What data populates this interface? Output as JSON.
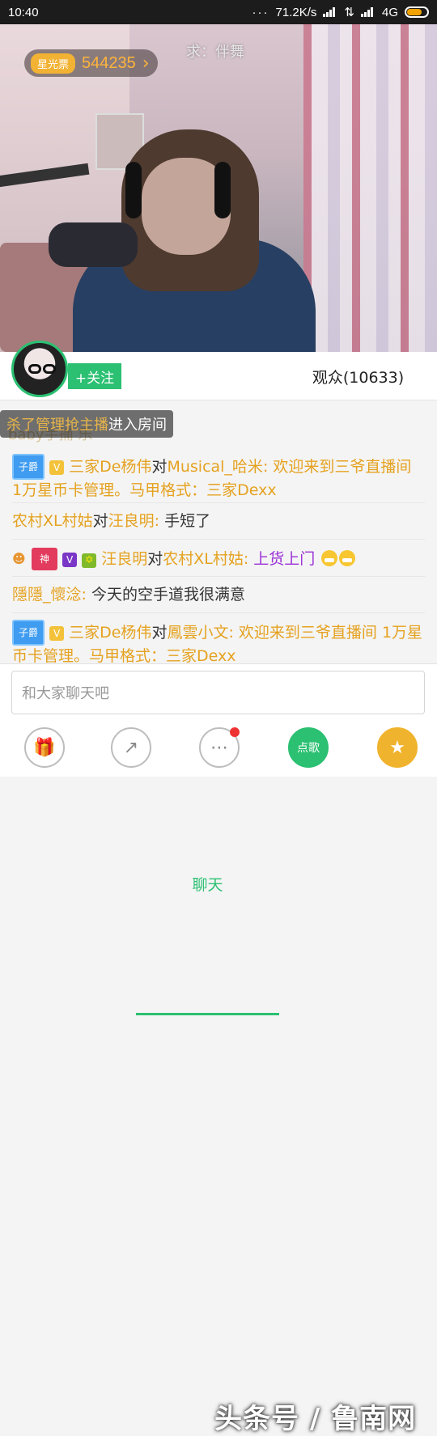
{
  "status_bar": {
    "time": "10:40",
    "speed": "71.2K/s",
    "network": "4G"
  },
  "video": {
    "star_label": "星光票",
    "star_count": "544235",
    "star_arrow": "›",
    "caption": "求：伴舞"
  },
  "tabs": {
    "follow": "+关注",
    "chat": "聊天",
    "audience": "观众(10633)"
  },
  "chat": {
    "notice_ghost": "baby手捕 乐",
    "notice_who": "杀了管理抢主播",
    "notice_text": "进入房间",
    "badge_zi": "子爵",
    "badge_v": "V",
    "badge_shen": "神",
    "messages": [
      {
        "name": "三家De杨伟",
        "to_word": "对",
        "target": "Musical_哈米",
        "colon": ": ",
        "text": "欢迎来到三爷直播间 1万星币卡管理。马甲格式：三家Dexx"
      },
      {
        "name": "农村XL村姑",
        "to_word": "对",
        "target": "汪良明",
        "colon": ": ",
        "text": "手短了"
      },
      {
        "name": "汪良明",
        "to_word": "对",
        "target": "农村XL村姑",
        "colon": ": ",
        "text": "上货上门"
      },
      {
        "name": "隱隱_懷淰",
        "colon": ": ",
        "text": "今天的空手道我很满意"
      },
      {
        "name": "三家De杨伟",
        "to_word": "对",
        "target": "鳳雲小文",
        "colon": ": ",
        "text": "欢迎来到三爷直播间 1万星币卡管理。马甲格式：三家Dexx"
      }
    ]
  },
  "input": {
    "placeholder": "和大家聊天吧",
    "song_label": "点歌"
  },
  "watermark": "头条号 / 鲁南网",
  "colors": {
    "accent": "#2bc072",
    "name": "#e5a220",
    "purple": "#9b2fd6"
  }
}
